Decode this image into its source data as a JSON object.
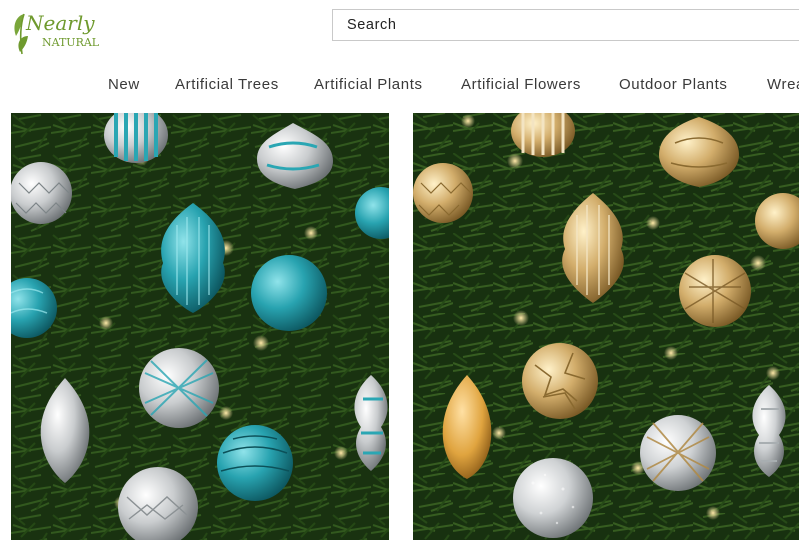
{
  "brand": {
    "logo_text_top": "Nearly",
    "logo_text_bottom": "NATURAL",
    "logo_color": "#6f9a2e"
  },
  "search": {
    "placeholder": "Search",
    "value": ""
  },
  "nav": {
    "items": [
      {
        "label": "New"
      },
      {
        "label": "Artificial Trees"
      },
      {
        "label": "Artificial Plants"
      },
      {
        "label": "Artificial Flowers"
      },
      {
        "label": "Outdoor Plants"
      },
      {
        "label": "Wrea"
      }
    ]
  },
  "colors": {
    "nav_text": "#3a3a3a",
    "tree_green": "#1f3d14",
    "teal": "#2aa6b3",
    "gold": "#c9a45e",
    "silver": "#d7d9da"
  },
  "gallery": [
    {
      "theme": "teal and silver ornaments on artificial tree"
    },
    {
      "theme": "gold and silver ornaments on artificial tree"
    }
  ]
}
